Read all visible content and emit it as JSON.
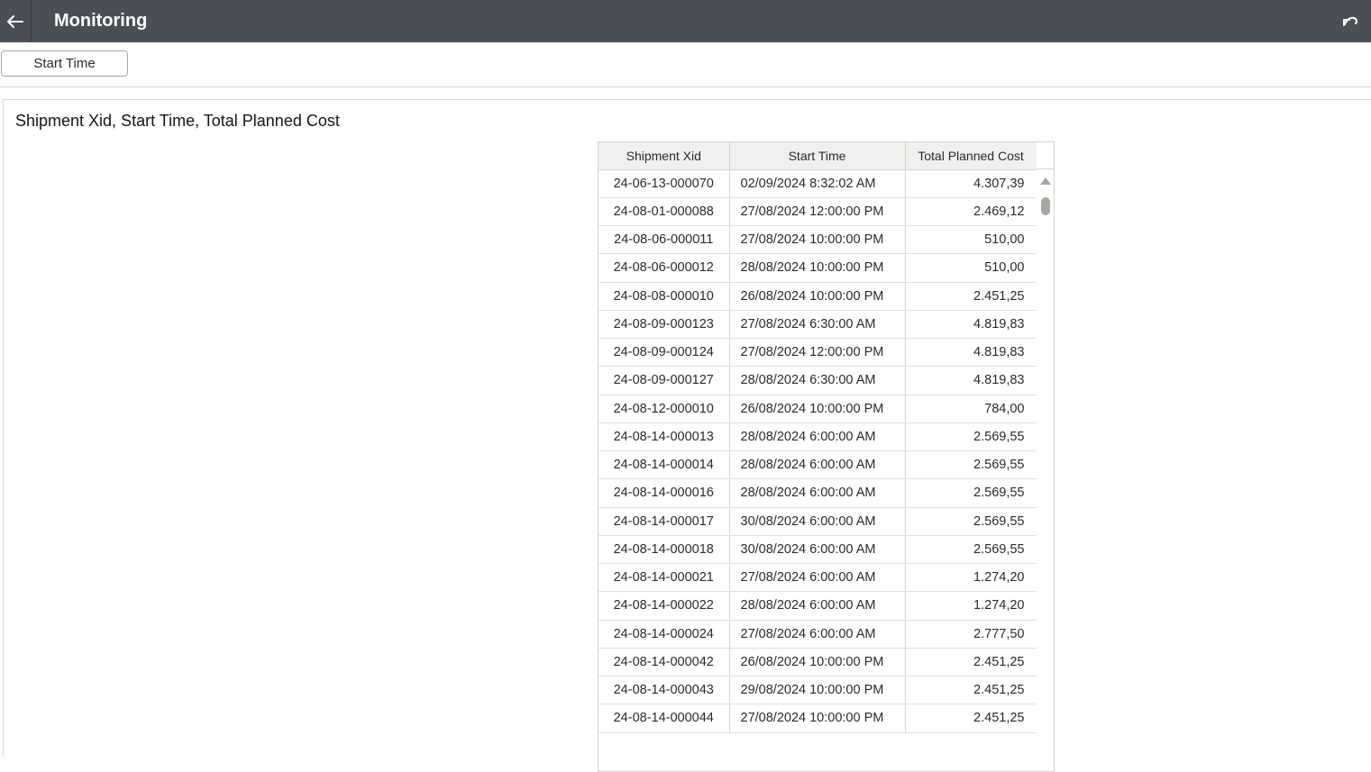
{
  "header": {
    "back_icon": "arrow-left-icon",
    "title": "Monitoring",
    "undo_icon": "undo-icon"
  },
  "filters": {
    "start_time_label": "Start Time"
  },
  "panel": {
    "title": "Shipment Xid, Start Time, Total Planned Cost"
  },
  "table": {
    "columns": [
      "Shipment Xid",
      "Start Time",
      "Total Planned Cost"
    ],
    "rows": [
      [
        "24-06-13-000070",
        "02/09/2024 8:32:02 AM",
        "4.307,39"
      ],
      [
        "24-08-01-000088",
        "27/08/2024 12:00:00 PM",
        "2.469,12"
      ],
      [
        "24-08-06-000011",
        "27/08/2024 10:00:00 PM",
        "510,00"
      ],
      [
        "24-08-06-000012",
        "28/08/2024 10:00:00 PM",
        "510,00"
      ],
      [
        "24-08-08-000010",
        "26/08/2024 10:00:00 PM",
        "2.451,25"
      ],
      [
        "24-08-09-000123",
        "27/08/2024 6:30:00 AM",
        "4.819,83"
      ],
      [
        "24-08-09-000124",
        "27/08/2024 12:00:00 PM",
        "4.819,83"
      ],
      [
        "24-08-09-000127",
        "28/08/2024 6:30:00 AM",
        "4.819,83"
      ],
      [
        "24-08-12-000010",
        "26/08/2024 10:00:00 PM",
        "784,00"
      ],
      [
        "24-08-14-000013",
        "28/08/2024 6:00:00 AM",
        "2.569,55"
      ],
      [
        "24-08-14-000014",
        "28/08/2024 6:00:00 AM",
        "2.569,55"
      ],
      [
        "24-08-14-000016",
        "28/08/2024 6:00:00 AM",
        "2.569,55"
      ],
      [
        "24-08-14-000017",
        "30/08/2024 6:00:00 AM",
        "2.569,55"
      ],
      [
        "24-08-14-000018",
        "30/08/2024 6:00:00 AM",
        "2.569,55"
      ],
      [
        "24-08-14-000021",
        "27/08/2024 6:00:00 AM",
        "1.274,20"
      ],
      [
        "24-08-14-000022",
        "28/08/2024 6:00:00 AM",
        "1.274,20"
      ],
      [
        "24-08-14-000024",
        "27/08/2024 6:00:00 AM",
        "2.777,50"
      ],
      [
        "24-08-14-000042",
        "26/08/2024 10:00:00 PM",
        "2.451,25"
      ],
      [
        "24-08-14-000043",
        "29/08/2024 10:00:00 PM",
        "2.451,25"
      ],
      [
        "24-08-14-000044",
        "27/08/2024 10:00:00 PM",
        "2.451,25"
      ]
    ]
  },
  "scrollbar": {
    "up_icon": "triangle-up-icon"
  }
}
